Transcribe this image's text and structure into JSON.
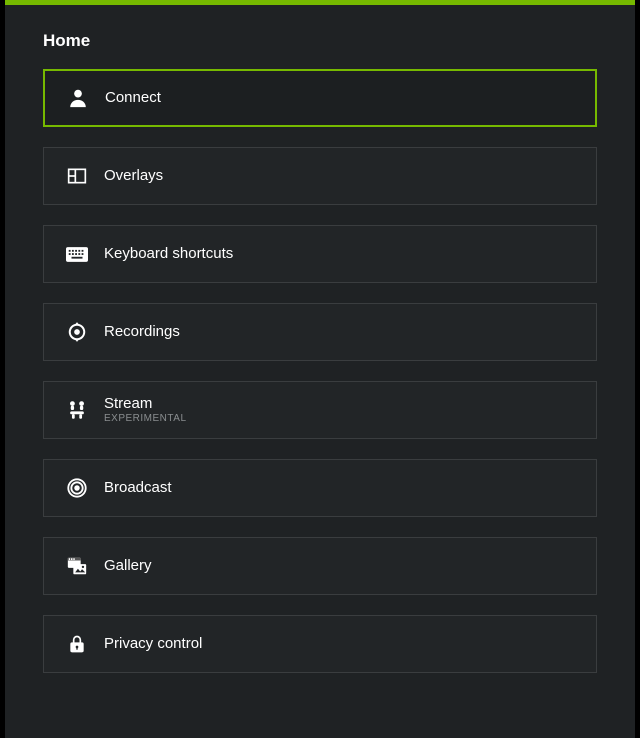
{
  "accent_color": "#76b900",
  "title": "Home",
  "selected_index": 0,
  "items": [
    {
      "label": "Connect",
      "sub": ""
    },
    {
      "label": "Overlays",
      "sub": ""
    },
    {
      "label": "Keyboard shortcuts",
      "sub": ""
    },
    {
      "label": "Recordings",
      "sub": ""
    },
    {
      "label": "Stream",
      "sub": "EXPERIMENTAL"
    },
    {
      "label": "Broadcast",
      "sub": ""
    },
    {
      "label": "Gallery",
      "sub": ""
    },
    {
      "label": "Privacy control",
      "sub": ""
    }
  ]
}
